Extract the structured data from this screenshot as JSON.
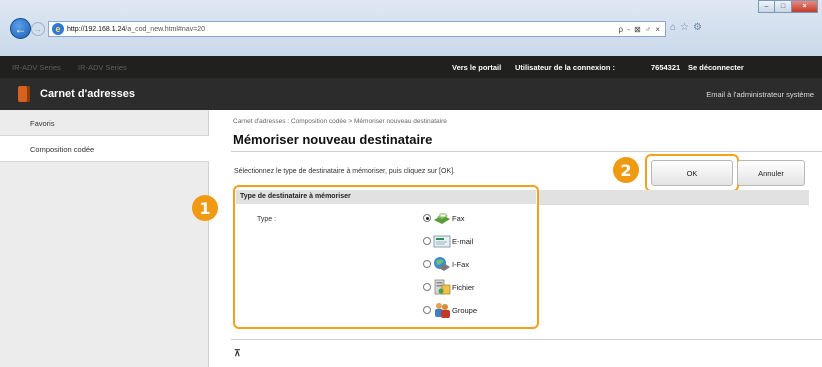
{
  "browser": {
    "url_host": "http://192.168.1.24",
    "url_path": "/a_cod_new.html#nav=20",
    "address_controls": "ρ - ⊠ ♂ ×",
    "window_buttons": [
      "–",
      "□",
      "×"
    ]
  },
  "header": {
    "device_name": "IR-ADV Series",
    "portal_link": "Vers le portail",
    "login_user_label": "Utilisateur de la connexion :",
    "login_user_value": "7654321",
    "logout_link": "Se déconnecter",
    "app_title": "Carnet d'adresses",
    "mail_admin_link": "Email à l'administrateur système"
  },
  "sidebar": {
    "items": [
      {
        "label": "Favoris"
      },
      {
        "label": "Composition codée"
      }
    ]
  },
  "main": {
    "breadcrumb": "Carnet d'adresses : Composition codée > Mémoriser nouveau destinataire",
    "title": "Mémoriser nouveau destinataire",
    "instruction": "Sélectionnez le type de destinataire à mémoriser, puis cliquez sur [OK].",
    "ok_label": "OK",
    "cancel_label": "Annuler",
    "section_title": "Type de destinataire à mémoriser",
    "type_label": "Type :",
    "options": [
      {
        "label": "Fax",
        "icon": "fax-icon",
        "selected": true
      },
      {
        "label": "E-mail",
        "icon": "email-icon",
        "selected": false
      },
      {
        "label": "I-Fax",
        "icon": "ifax-icon",
        "selected": false
      },
      {
        "label": "Fichier",
        "icon": "file-server-icon",
        "selected": false
      },
      {
        "label": "Groupe",
        "icon": "group-icon",
        "selected": false
      }
    ],
    "top_link": "⊼"
  },
  "callouts": {
    "one": "1",
    "two": "2"
  },
  "colors": {
    "callout": "#f09a14",
    "header_dark": "#20201f",
    "title_bar": "#2c2c2c"
  }
}
